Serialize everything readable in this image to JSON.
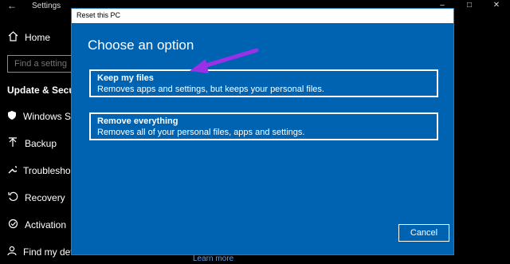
{
  "settings": {
    "title": "Settings",
    "back_icon": "back-arrow-icon",
    "home_label": "Home",
    "search_placeholder": "Find a setting",
    "section_title": "Update & Security",
    "nav": [
      {
        "label": "Windows Security",
        "icon": "shield-icon"
      },
      {
        "label": "Backup",
        "icon": "backup-icon"
      },
      {
        "label": "Troubleshoot",
        "icon": "wrench-icon"
      },
      {
        "label": "Recovery",
        "icon": "recovery-icon"
      },
      {
        "label": "Activation",
        "icon": "activation-icon"
      },
      {
        "label": "Find my device",
        "icon": "person-icon"
      }
    ],
    "learn_more": "Learn more"
  },
  "dialog": {
    "title": "Reset this PC",
    "heading": "Choose an option",
    "options": [
      {
        "title": "Keep my files",
        "description": "Removes apps and settings, but keeps your personal files."
      },
      {
        "title": "Remove everything",
        "description": "Removes all of your personal files, apps and settings."
      }
    ],
    "cancel_label": "Cancel"
  },
  "colors": {
    "dialog_bg": "#0063b1",
    "annotation_arrow": "#9b30e6"
  }
}
